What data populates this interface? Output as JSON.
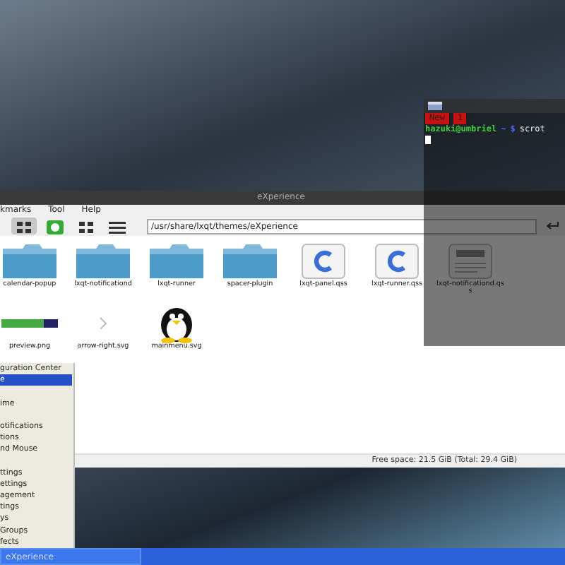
{
  "file_manager": {
    "title": "eXperience",
    "menu": [
      "kmarks",
      "Tool",
      "Help"
    ],
    "view_buttons": [
      {
        "kind": "icons",
        "selected": true
      },
      {
        "kind": "preview",
        "selected": false
      },
      {
        "kind": "compact",
        "selected": false
      },
      {
        "kind": "list",
        "selected": false
      }
    ],
    "path": "/usr/share/lxqt/themes/eXperience",
    "files": [
      {
        "name": "calendar-popup",
        "kind": "folder"
      },
      {
        "name": "lxqt-notificationd",
        "kind": "folder"
      },
      {
        "name": "lxqt-runner",
        "kind": "folder"
      },
      {
        "name": "spacer-plugin",
        "kind": "folder"
      },
      {
        "name": "lxqt-panel.qss",
        "kind": "css"
      },
      {
        "name": "lxqt-runner.qss",
        "kind": "css"
      },
      {
        "name": "lxqt-notificationd.qss",
        "kind": "text"
      },
      {
        "name": "preview.png",
        "kind": "image"
      },
      {
        "name": "arrow-right.svg",
        "kind": "arrow"
      },
      {
        "name": "mainmenu.svg",
        "kind": "penguin"
      }
    ],
    "status_bar": "Free space: 21.5 GiB (Total: 29.4 GiB)"
  },
  "terminal": {
    "tabs": [
      "New",
      "1"
    ],
    "user_host": "hazuki@umbriel",
    "cwd": "~",
    "prompt": "$",
    "command": "scrot"
  },
  "start_menu": {
    "items": [
      {
        "label": "guration Center",
        "kind": "header",
        "selected": false,
        "gap_before": false
      },
      {
        "label": "e",
        "kind": "item",
        "selected": true,
        "gap_before": false
      },
      {
        "label": "ime",
        "kind": "item",
        "selected": false,
        "gap_before": true
      },
      {
        "label": "otifications",
        "kind": "item",
        "selected": false,
        "gap_before": true
      },
      {
        "label": "tions",
        "kind": "item",
        "selected": false,
        "gap_before": false
      },
      {
        "label": "nd Mouse",
        "kind": "item",
        "selected": false,
        "gap_before": false
      },
      {
        "label": "ttings",
        "kind": "item",
        "selected": false,
        "gap_before": true
      },
      {
        "label": "ettings",
        "kind": "item",
        "selected": false,
        "gap_before": false
      },
      {
        "label": "agement",
        "kind": "item",
        "selected": false,
        "gap_before": false
      },
      {
        "label": "tings",
        "kind": "item",
        "selected": false,
        "gap_before": false
      },
      {
        "label": "ys",
        "kind": "item",
        "selected": false,
        "gap_before": false
      },
      {
        "label": "Groups",
        "kind": "item",
        "selected": false,
        "gap_before": false
      },
      {
        "label": "fects",
        "kind": "item",
        "selected": false,
        "gap_before": false
      }
    ]
  },
  "taskbar": {
    "tasks": [
      {
        "label": "eXperience",
        "selected": true
      }
    ]
  }
}
